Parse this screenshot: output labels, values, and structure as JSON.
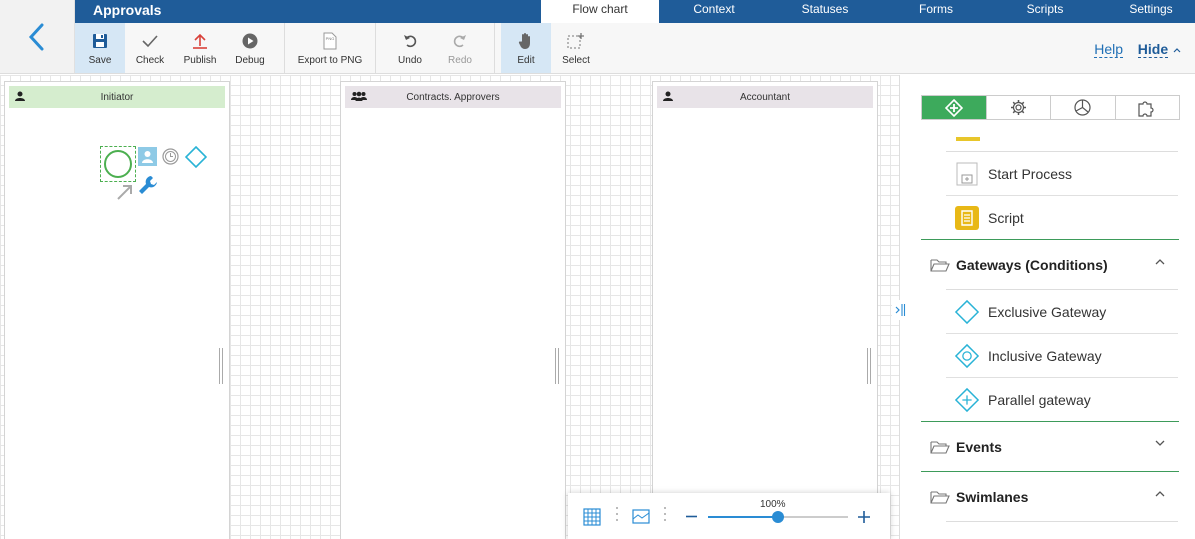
{
  "app": {
    "title": "Approvals"
  },
  "tabs": [
    {
      "label": "Flow chart",
      "active": true
    },
    {
      "label": "Context"
    },
    {
      "label": "Statuses"
    },
    {
      "label": "Forms"
    },
    {
      "label": "Scripts"
    },
    {
      "label": "Settings"
    }
  ],
  "toolbar": {
    "save": "Save",
    "check": "Check",
    "publish": "Publish",
    "debug": "Debug",
    "export_png": "Export to PNG",
    "export_icon_text": "PNG",
    "undo": "Undo",
    "redo": "Redo",
    "edit": "Edit",
    "select": "Select",
    "help": "Help",
    "hide": "Hide"
  },
  "lanes": [
    {
      "title": "Initiator",
      "icon": "user-icon",
      "header_color": "#d5edce"
    },
    {
      "title": "Contracts. Approvers",
      "icon": "users-group-icon",
      "header_color": "#e8e3e8"
    },
    {
      "title": "Accountant",
      "icon": "user-icon",
      "header_color": "#e8e3e8"
    }
  ],
  "zoom": {
    "level_text": "100%",
    "level": 0.5
  },
  "panel": {
    "tabs": [
      "elements-icon",
      "gear-icon",
      "chart-icon",
      "puzzle-icon"
    ],
    "items_activities": [
      {
        "label": "Start Process",
        "icon": "start-process-icon"
      },
      {
        "label": "Script",
        "icon": "script-icon"
      }
    ],
    "gateways": {
      "title": "Gateways (Conditions)",
      "expanded": true,
      "items": [
        {
          "label": "Exclusive Gateway",
          "icon": "exclusive-gateway-icon"
        },
        {
          "label": "Inclusive Gateway",
          "icon": "inclusive-gateway-icon"
        },
        {
          "label": "Parallel gateway",
          "icon": "parallel-gateway-icon"
        }
      ]
    },
    "events": {
      "title": "Events",
      "expanded": false
    },
    "swimlanes": {
      "title": "Swimlanes",
      "expanded": true
    }
  },
  "colors": {
    "brand": "#1f5c99",
    "accent": "#2a8cd4",
    "green": "#3daa5c",
    "gateway": "#29b3d6"
  }
}
